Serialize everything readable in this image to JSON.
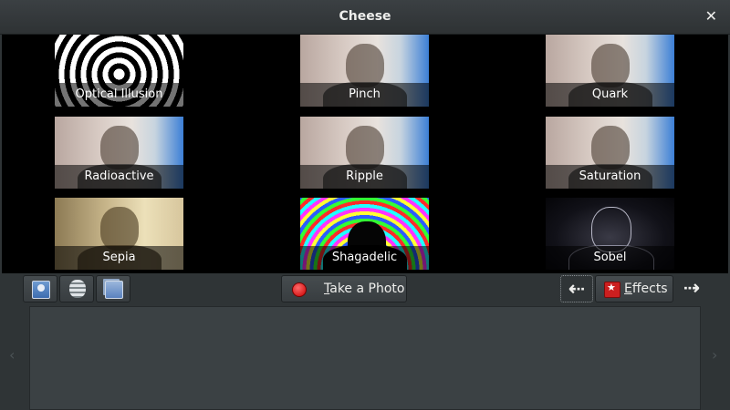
{
  "window": {
    "title": "Cheese",
    "close_glyph": "✕"
  },
  "effects": [
    {
      "name": "Optical Illusion",
      "style": "spiral"
    },
    {
      "name": "Pinch",
      "style": "normal"
    },
    {
      "name": "Quark",
      "style": "normal"
    },
    {
      "name": "Radioactive",
      "style": "normal"
    },
    {
      "name": "Ripple",
      "style": "normal"
    },
    {
      "name": "Saturation",
      "style": "normal"
    },
    {
      "name": "Sepia",
      "style": "sepia"
    },
    {
      "name": "Shagadelic",
      "style": "shag"
    },
    {
      "name": "Sobel",
      "style": "sobel"
    }
  ],
  "toolbar": {
    "photo_mode_icon": "photo-mode-icon",
    "burst_mode_icon": "burst-mode-icon",
    "video_mode_icon": "video-mode-icon",
    "take_photo_label": "Take a Photo",
    "take_photo_mnemonic": "T",
    "take_photo_rest": "ake a Photo",
    "record_color": "#e00000",
    "prev_glyph": "⇠",
    "next_glyph": "⇢",
    "effects_label": "Effects",
    "effects_mnemonic": "E",
    "effects_rest": "ffects",
    "effects_icon_color": "#cc1f1f"
  },
  "thumbnails": {
    "left_arrow": "‹",
    "right_arrow": "›"
  }
}
